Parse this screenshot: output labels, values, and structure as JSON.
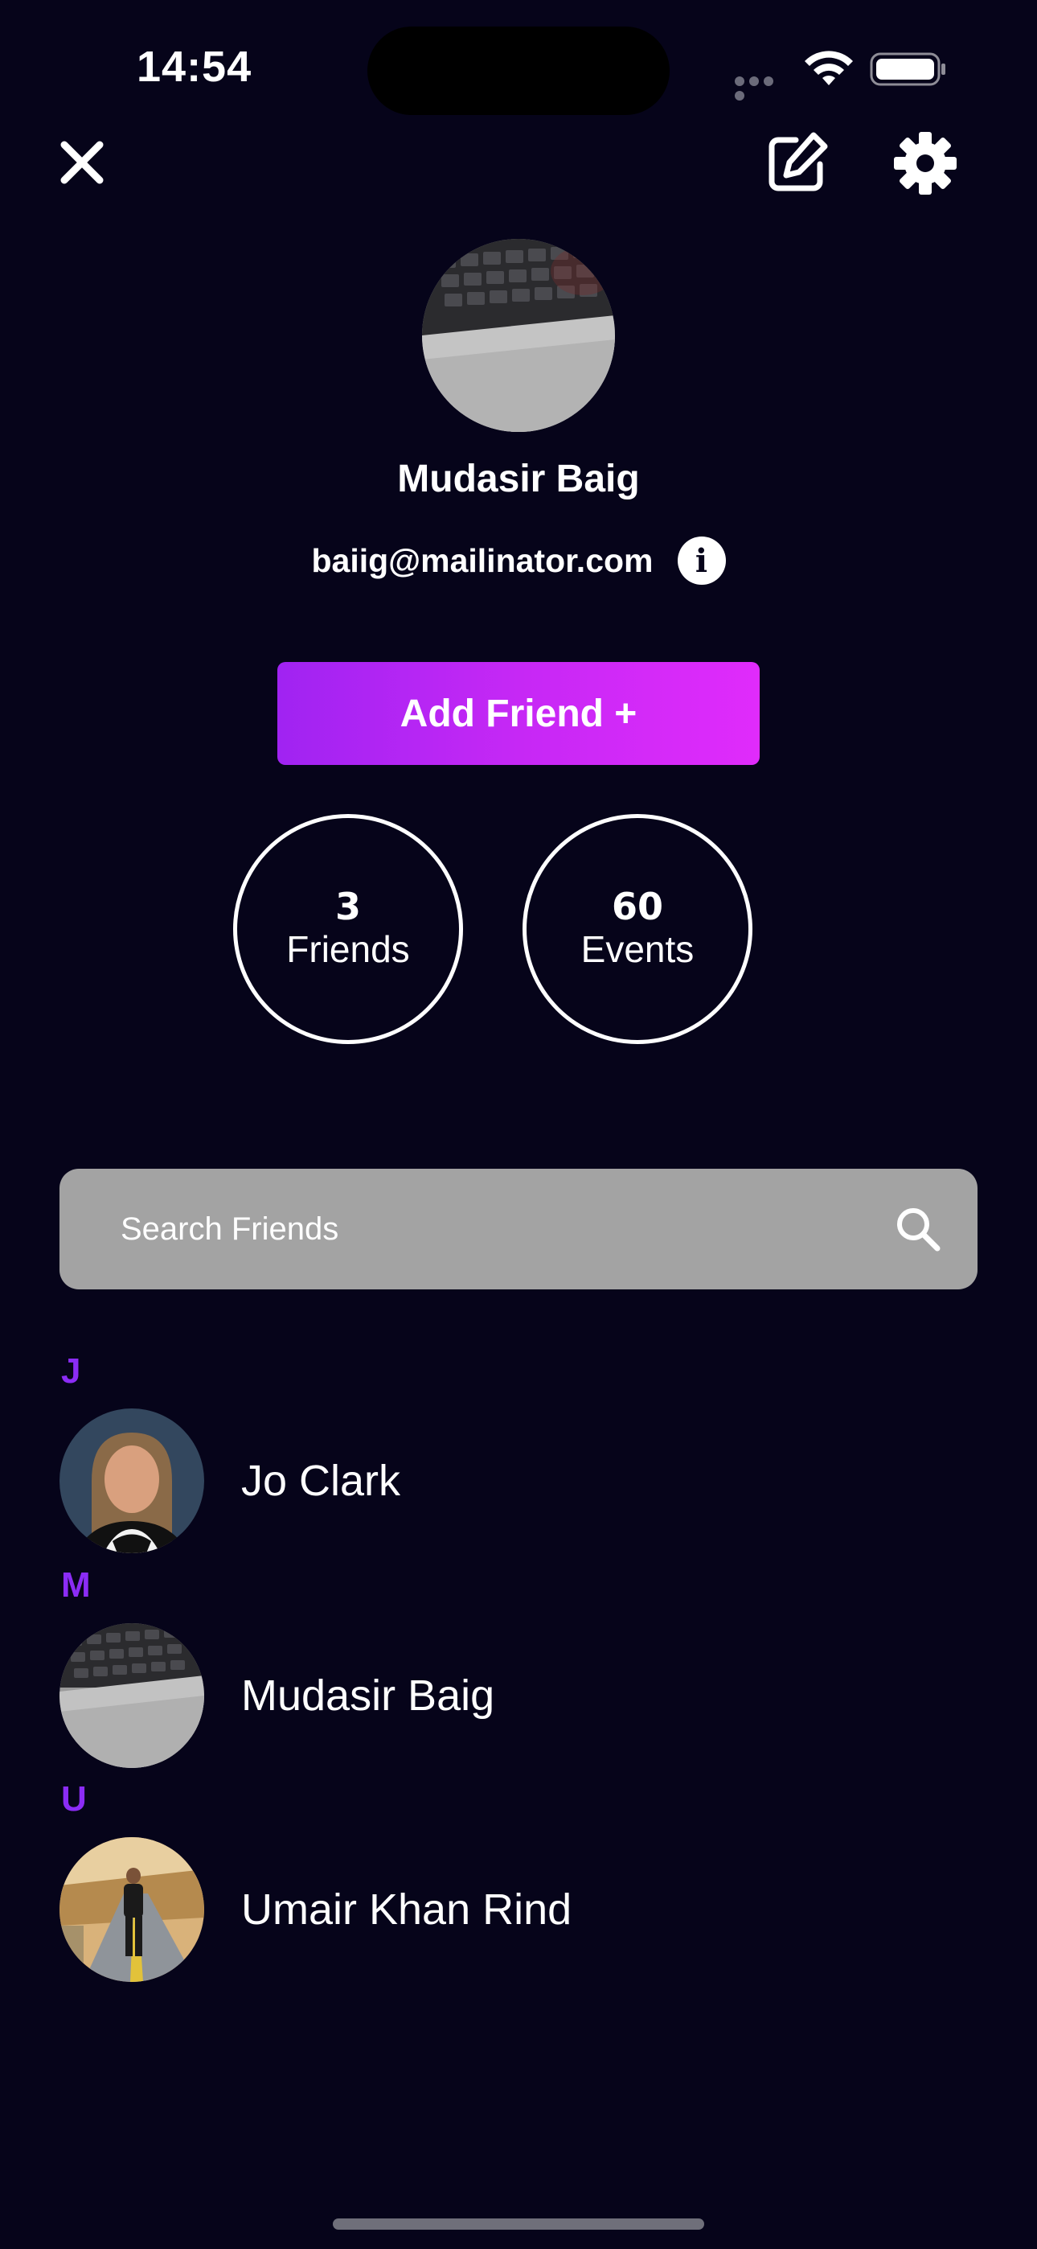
{
  "status_bar": {
    "time": "14:54"
  },
  "profile": {
    "name": "Mudasir Baig",
    "email": "baiig@mailinator.com"
  },
  "actions": {
    "add_friend_label": "Add Friend +"
  },
  "stats": {
    "friends_count": "3",
    "friends_label": "Friends",
    "events_count": "60",
    "events_label": "Events"
  },
  "search": {
    "placeholder": "Search Friends"
  },
  "friends": {
    "sections": [
      {
        "letter": "J",
        "name": "Jo Clark"
      },
      {
        "letter": "M",
        "name": "Mudasir Baig"
      },
      {
        "letter": "U",
        "name": "Umair Khan Rind"
      }
    ]
  },
  "icons": {
    "close": "close-icon",
    "edit": "edit-icon",
    "settings": "gear-icon",
    "info": "info-icon",
    "search": "search-icon",
    "wifi": "wifi-icon",
    "battery": "battery-icon"
  },
  "colors": {
    "background": "#06041a",
    "accent_letter": "#8b2cf5",
    "button_gradient_start": "#a023f2",
    "button_gradient_end": "#e02bfb",
    "search_background": "#a3a3a3"
  }
}
